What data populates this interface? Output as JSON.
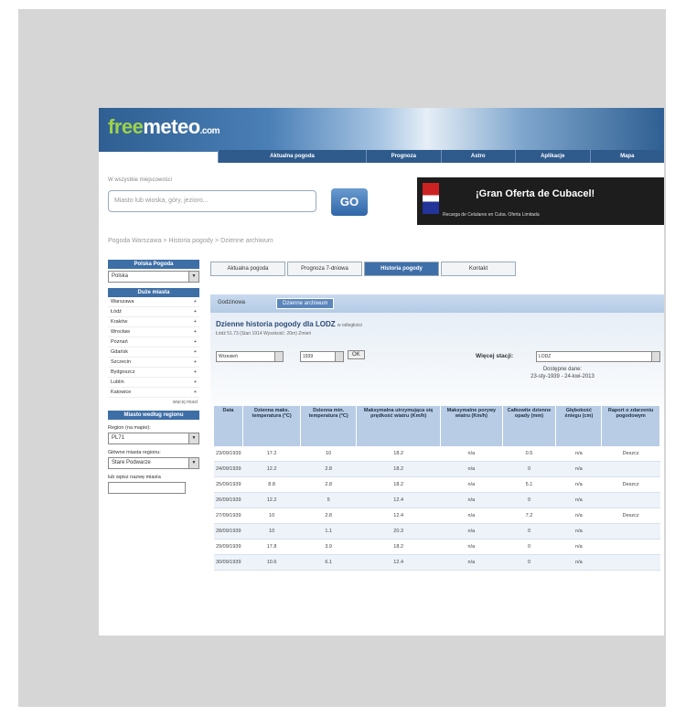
{
  "header": {
    "logo_main": "free",
    "logo_accent": "meteo",
    "logo_suffix": ".com",
    "nav": [
      "Aktualna pogoda",
      "Prognoza",
      "Astro",
      "Aplikacje",
      "Mapa"
    ]
  },
  "search": {
    "label": "W wszystkie miejscowości",
    "placeholder": "Miasto lub wioska, góry, jezioro...",
    "go_label": "GO"
  },
  "ad": {
    "title": "¡Gran Oferta de Cubacel!",
    "subtitle": "Recarga de Celulares en Cuba. Oferta Limitada"
  },
  "breadcrumb": "Pogoda Warszawa > Historia pogody > Dzienne archiwum",
  "sidebar": {
    "header1": "Polska Pogoda",
    "country_select": "Polska",
    "header2": "Duże miasta",
    "cities": [
      "Warszawa",
      "Łódź",
      "Kraków",
      "Wrocław",
      "Poznań",
      "Gdańsk",
      "Szczecin",
      "Bydgoszcz",
      "Lublin",
      "Katowice"
    ],
    "more": "więcej miast",
    "header3": "Miasto według regionu",
    "region_label": "Region (na mapie):",
    "region_select": "PL71",
    "city_select_label": "Główne miasta regionu:",
    "city_select": "Stare Podwarze",
    "search_label": "lub wpisz nazwę miasta"
  },
  "tabs": [
    "Aktualna pogoda",
    "Prognoza 7-dniowa",
    "Historia pogody",
    "Kontakt"
  ],
  "active_tab": "Historia pogody",
  "subtabs": [
    "Godzinowa",
    "Dzienne archiwum"
  ],
  "page": {
    "title": "Dzienne historia pogody dla LODZ",
    "title_hint": "w odległości",
    "meta": "Łódź 51.73 (Stan 1914 Wysokość: 20m)  Zmień",
    "month": "Wrzesień",
    "year": "1939",
    "ok_label": "OK",
    "station_label": "Więcej stacji:",
    "station_value": "LODZ",
    "available_label": "Dostępne dane:",
    "available_range": "23-sty-1939 - 24-kwi-2013"
  },
  "table": {
    "headers": [
      "Data",
      "Dzienna maks. temperatura (°C)",
      "Dzienna min. temperatura (°C)",
      "Maksymalna utrzymująca się prędkość wiatru (Km/h)",
      "Maksymalne porywy wiatru (Km/h)",
      "Całkowite dzienne opady (mm)",
      "Głębokość śniegu (cm)",
      "Raport o zdarzeniu pogodowym"
    ],
    "rows": [
      [
        "23/09/1939",
        "17.2",
        "10",
        "18.2",
        "n/a",
        "0.5",
        "n/a",
        "Deszcz"
      ],
      [
        "24/09/1939",
        "12.2",
        "2.8",
        "18.2",
        "n/a",
        "0",
        "n/a",
        ""
      ],
      [
        "25/09/1939",
        "8.8",
        "2.8",
        "18.2",
        "n/a",
        "5.1",
        "n/a",
        "Deszcz"
      ],
      [
        "26/09/1939",
        "12.2",
        "5",
        "12.4",
        "n/a",
        "0",
        "n/a",
        ""
      ],
      [
        "27/09/1939",
        "10",
        "2.8",
        "12.4",
        "n/a",
        "7.2",
        "n/a",
        "Deszcz"
      ],
      [
        "28/09/1939",
        "10",
        "1.1",
        "20.3",
        "n/a",
        "0",
        "n/a",
        ""
      ],
      [
        "29/09/1939",
        "17.8",
        "3.9",
        "18.2",
        "n/a",
        "0",
        "n/a",
        ""
      ],
      [
        "30/09/1939",
        "10.6",
        "6.1",
        "12.4",
        "n/a",
        "0",
        "n/a",
        ""
      ]
    ]
  },
  "colors": {
    "brand_blue": "#3d6ea6",
    "logo_green": "#9ed24a",
    "header_cell": "#b8cce5"
  }
}
